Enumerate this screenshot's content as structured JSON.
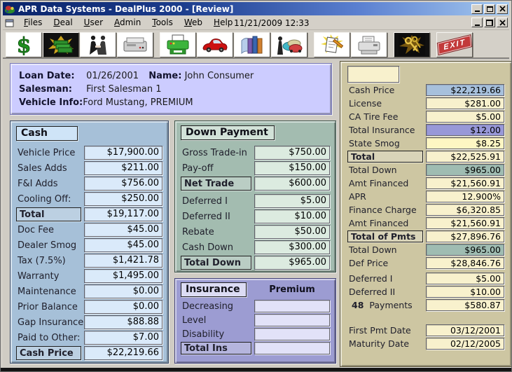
{
  "window": {
    "title": "APR Data Systems - DealPlus 2000 - [Review]",
    "datetime": "11/21/2009 12:33"
  },
  "menu": {
    "items": [
      "Files",
      "Deal",
      "User",
      "Admin",
      "Tools",
      "Web",
      "Help"
    ]
  },
  "toolbar": {
    "exit_label": "EXIT",
    "buttons": [
      {
        "id": "dollar",
        "name": "dollar-sign-icon"
      },
      {
        "id": "cash",
        "name": "money-stack-icon",
        "dark": true
      },
      {
        "id": "handshake",
        "name": "handshake-icon"
      },
      {
        "id": "fax",
        "name": "fax-machine-icon"
      },
      {
        "id": "printer",
        "name": "printer-icon",
        "gap": true
      },
      {
        "id": "car",
        "name": "red-car-icon"
      },
      {
        "id": "books",
        "name": "books-icon"
      },
      {
        "id": "sales",
        "name": "salesman-cars-icon"
      },
      {
        "id": "contract",
        "name": "contract-pencil-icon",
        "gap": true
      },
      {
        "id": "copier",
        "name": "copier-icon"
      },
      {
        "id": "keys",
        "name": "keys-icon",
        "dark": true,
        "gap": true
      },
      {
        "id": "exit",
        "name": "exit-sign-icon",
        "gap": true
      }
    ]
  },
  "info": {
    "loan_date_label": "Loan Date:",
    "loan_date": "01/26/2001",
    "name_label": "Name:",
    "name": "John Consumer",
    "salesman_label": "Salesman:",
    "salesman": "First Salesman 1",
    "vehicle_label": "Vehicle Info:",
    "vehicle": "Ford Mustang, PREMIUM"
  },
  "cash_panel": {
    "title": "Cash",
    "rows": [
      {
        "label": "Vehicle Price",
        "value": "$17,900.00"
      },
      {
        "label": "Sales Adds",
        "value": "$211.00"
      },
      {
        "label": "F&I Adds",
        "value": "$756.00"
      },
      {
        "label": "Cooling Off:",
        "value": "$250.00"
      },
      {
        "label": "Total",
        "value": "$19,117.00",
        "total": true
      },
      {
        "label": "Doc Fee",
        "value": "$45.00"
      },
      {
        "label": "Dealer Smog",
        "value": "$45.00"
      },
      {
        "label": "Tax (7.5%)",
        "value": "$1,421.78"
      },
      {
        "label": "Warranty",
        "value": "$1,495.00"
      },
      {
        "label": "Maintenance",
        "value": "$0.00"
      },
      {
        "label": "Prior Balance",
        "value": "$0.00"
      },
      {
        "label": "Gap Insurance",
        "value": "$88.88"
      },
      {
        "label": "Paid to Other:",
        "value": "$7.00"
      },
      {
        "label": "Cash Price",
        "value": "$22,219.66",
        "total": true
      }
    ]
  },
  "down_payment_panel": {
    "title": "Down Payment",
    "rows": [
      {
        "label": "Gross Trade-in",
        "value": "$750.00"
      },
      {
        "label": "Pay-off",
        "value": "$150.00"
      },
      {
        "label": "Net Trade",
        "value": "$600.00",
        "total": true
      },
      {
        "label": "Deferred I",
        "value": "$5.00",
        "gap": "sm"
      },
      {
        "label": "Deferred II",
        "value": "$10.00"
      },
      {
        "label": "Rebate",
        "value": "$50.00"
      },
      {
        "label": "Cash Down",
        "value": "$300.00"
      },
      {
        "label": "Total Down",
        "value": "$965.00",
        "total": true
      }
    ]
  },
  "insurance_panel": {
    "title": "Insurance",
    "premium_header": "Premium",
    "rows": [
      {
        "label": "Decreasing",
        "value": ""
      },
      {
        "label": "Level",
        "value": ""
      },
      {
        "label": "Disability",
        "value": ""
      },
      {
        "label": "Total Ins",
        "value": "",
        "total": true
      }
    ]
  },
  "summary_panel": {
    "rows": [
      {
        "label": "Cash Price",
        "value": "$22,219.66",
        "style": "blue"
      },
      {
        "label": "License",
        "value": "$281.00"
      },
      {
        "label": "CA Tire Fee",
        "value": "$5.00"
      },
      {
        "label": "Total Insurance",
        "value": "$12.00",
        "style": "purple"
      },
      {
        "label": "State Smog",
        "value": "$8.25",
        "style": "yellow"
      },
      {
        "label": "Total",
        "value": "$22,525.91",
        "total": true
      },
      {
        "label": "Total Down",
        "value": "$965.00",
        "style": "green"
      },
      {
        "label": "Amt Financed",
        "value": "$21,560.91"
      },
      {
        "label": "APR",
        "value": "12.900%"
      },
      {
        "label": "Finance Charge",
        "value": "$6,320.85"
      },
      {
        "label": "Amt Financed",
        "value": "$21,560.91"
      },
      {
        "label": "Total of Pmts",
        "value": "$27,896.76",
        "total": true
      },
      {
        "label": "Total Down",
        "value": "$965.00",
        "style": "green"
      },
      {
        "label": "Def Price",
        "value": "$28,846.76"
      },
      {
        "label": "Deferred I",
        "value": "$5.00",
        "gap": "sm"
      },
      {
        "label": "Deferred II",
        "value": "$10.00"
      },
      {
        "label": "Payments",
        "value": "$580.87",
        "label_bold_prefix": "48"
      },
      {
        "label": "First Pmt Date",
        "value": "03/12/2001",
        "gap": "lg"
      },
      {
        "label": "Maturity Date",
        "value": "02/12/2005"
      }
    ]
  }
}
